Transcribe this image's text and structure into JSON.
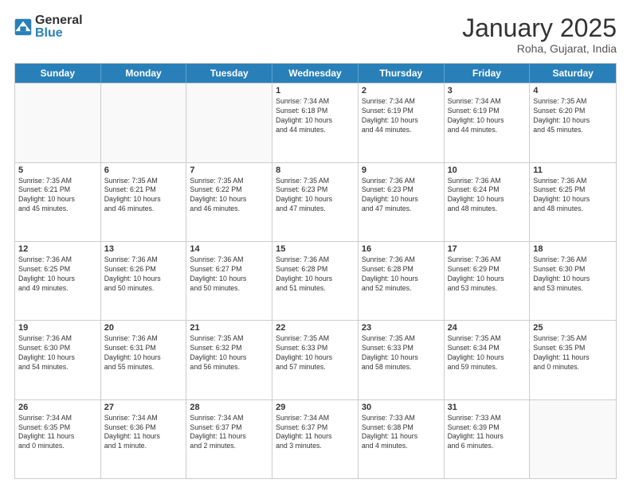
{
  "header": {
    "logo_general": "General",
    "logo_blue": "Blue",
    "month_title": "January 2025",
    "subtitle": "Roha, Gujarat, India"
  },
  "weekdays": [
    "Sunday",
    "Monday",
    "Tuesday",
    "Wednesday",
    "Thursday",
    "Friday",
    "Saturday"
  ],
  "rows": [
    [
      {
        "day": "",
        "info": ""
      },
      {
        "day": "",
        "info": ""
      },
      {
        "day": "",
        "info": ""
      },
      {
        "day": "1",
        "info": "Sunrise: 7:34 AM\nSunset: 6:18 PM\nDaylight: 10 hours\nand 44 minutes."
      },
      {
        "day": "2",
        "info": "Sunrise: 7:34 AM\nSunset: 6:19 PM\nDaylight: 10 hours\nand 44 minutes."
      },
      {
        "day": "3",
        "info": "Sunrise: 7:34 AM\nSunset: 6:19 PM\nDaylight: 10 hours\nand 44 minutes."
      },
      {
        "day": "4",
        "info": "Sunrise: 7:35 AM\nSunset: 6:20 PM\nDaylight: 10 hours\nand 45 minutes."
      }
    ],
    [
      {
        "day": "5",
        "info": "Sunrise: 7:35 AM\nSunset: 6:21 PM\nDaylight: 10 hours\nand 45 minutes."
      },
      {
        "day": "6",
        "info": "Sunrise: 7:35 AM\nSunset: 6:21 PM\nDaylight: 10 hours\nand 46 minutes."
      },
      {
        "day": "7",
        "info": "Sunrise: 7:35 AM\nSunset: 6:22 PM\nDaylight: 10 hours\nand 46 minutes."
      },
      {
        "day": "8",
        "info": "Sunrise: 7:35 AM\nSunset: 6:23 PM\nDaylight: 10 hours\nand 47 minutes."
      },
      {
        "day": "9",
        "info": "Sunrise: 7:36 AM\nSunset: 6:23 PM\nDaylight: 10 hours\nand 47 minutes."
      },
      {
        "day": "10",
        "info": "Sunrise: 7:36 AM\nSunset: 6:24 PM\nDaylight: 10 hours\nand 48 minutes."
      },
      {
        "day": "11",
        "info": "Sunrise: 7:36 AM\nSunset: 6:25 PM\nDaylight: 10 hours\nand 48 minutes."
      }
    ],
    [
      {
        "day": "12",
        "info": "Sunrise: 7:36 AM\nSunset: 6:25 PM\nDaylight: 10 hours\nand 49 minutes."
      },
      {
        "day": "13",
        "info": "Sunrise: 7:36 AM\nSunset: 6:26 PM\nDaylight: 10 hours\nand 50 minutes."
      },
      {
        "day": "14",
        "info": "Sunrise: 7:36 AM\nSunset: 6:27 PM\nDaylight: 10 hours\nand 50 minutes."
      },
      {
        "day": "15",
        "info": "Sunrise: 7:36 AM\nSunset: 6:28 PM\nDaylight: 10 hours\nand 51 minutes."
      },
      {
        "day": "16",
        "info": "Sunrise: 7:36 AM\nSunset: 6:28 PM\nDaylight: 10 hours\nand 52 minutes."
      },
      {
        "day": "17",
        "info": "Sunrise: 7:36 AM\nSunset: 6:29 PM\nDaylight: 10 hours\nand 53 minutes."
      },
      {
        "day": "18",
        "info": "Sunrise: 7:36 AM\nSunset: 6:30 PM\nDaylight: 10 hours\nand 53 minutes."
      }
    ],
    [
      {
        "day": "19",
        "info": "Sunrise: 7:36 AM\nSunset: 6:30 PM\nDaylight: 10 hours\nand 54 minutes."
      },
      {
        "day": "20",
        "info": "Sunrise: 7:36 AM\nSunset: 6:31 PM\nDaylight: 10 hours\nand 55 minutes."
      },
      {
        "day": "21",
        "info": "Sunrise: 7:35 AM\nSunset: 6:32 PM\nDaylight: 10 hours\nand 56 minutes."
      },
      {
        "day": "22",
        "info": "Sunrise: 7:35 AM\nSunset: 6:33 PM\nDaylight: 10 hours\nand 57 minutes."
      },
      {
        "day": "23",
        "info": "Sunrise: 7:35 AM\nSunset: 6:33 PM\nDaylight: 10 hours\nand 58 minutes."
      },
      {
        "day": "24",
        "info": "Sunrise: 7:35 AM\nSunset: 6:34 PM\nDaylight: 10 hours\nand 59 minutes."
      },
      {
        "day": "25",
        "info": "Sunrise: 7:35 AM\nSunset: 6:35 PM\nDaylight: 11 hours\nand 0 minutes."
      }
    ],
    [
      {
        "day": "26",
        "info": "Sunrise: 7:34 AM\nSunset: 6:35 PM\nDaylight: 11 hours\nand 0 minutes."
      },
      {
        "day": "27",
        "info": "Sunrise: 7:34 AM\nSunset: 6:36 PM\nDaylight: 11 hours\nand 1 minute."
      },
      {
        "day": "28",
        "info": "Sunrise: 7:34 AM\nSunset: 6:37 PM\nDaylight: 11 hours\nand 2 minutes."
      },
      {
        "day": "29",
        "info": "Sunrise: 7:34 AM\nSunset: 6:37 PM\nDaylight: 11 hours\nand 3 minutes."
      },
      {
        "day": "30",
        "info": "Sunrise: 7:33 AM\nSunset: 6:38 PM\nDaylight: 11 hours\nand 4 minutes."
      },
      {
        "day": "31",
        "info": "Sunrise: 7:33 AM\nSunset: 6:39 PM\nDaylight: 11 hours\nand 6 minutes."
      },
      {
        "day": "",
        "info": ""
      }
    ]
  ]
}
